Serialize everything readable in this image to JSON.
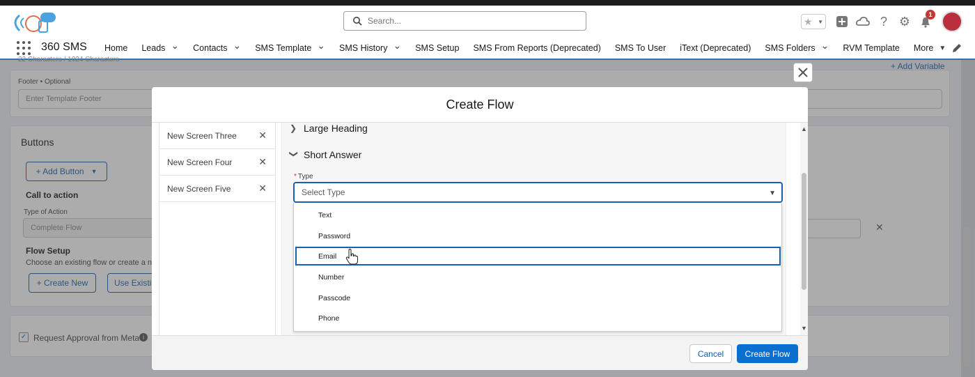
{
  "header": {
    "search_placeholder": "Search...",
    "notification_count": "1"
  },
  "nav": {
    "app_name": "360 SMS",
    "items": [
      {
        "label": "Home",
        "has_menu": false
      },
      {
        "label": "Leads",
        "has_menu": true
      },
      {
        "label": "Contacts",
        "has_menu": true
      },
      {
        "label": "SMS Template",
        "has_menu": true
      },
      {
        "label": "SMS History",
        "has_menu": true
      },
      {
        "label": "SMS Setup",
        "has_menu": false
      },
      {
        "label": "SMS From Reports (Deprecated)",
        "has_menu": false
      },
      {
        "label": "SMS To User",
        "has_menu": false
      },
      {
        "label": "iText (Deprecated)",
        "has_menu": false
      },
      {
        "label": "SMS Folders",
        "has_menu": true
      },
      {
        "label": "RVM Template",
        "has_menu": false
      },
      {
        "label": "More",
        "has_menu": true
      }
    ]
  },
  "background": {
    "char_count": "22 Characters / 1024 Characters",
    "footer_label": "Footer • Optional",
    "footer_placeholder": "Enter Template Footer",
    "add_variable": "+ Add Variable",
    "buttons_title": "Buttons",
    "add_button": "+ Add Button",
    "call_to_action": "Call to action",
    "type_of_action_label": "Type of Action",
    "type_of_action_value": "Complete Flow",
    "flow_setup_title": "Flow Setup",
    "flow_setup_desc": "Choose an existing flow or create a n",
    "create_new": "+ Create New",
    "use_existing": "Use Existin",
    "request_approval": "Request Approval from Meta"
  },
  "modal": {
    "title": "Create Flow",
    "screens": [
      "New Screen Three",
      "New Screen Four",
      "New Screen Five"
    ],
    "sections": {
      "large_heading": "Large Heading",
      "short_answer": "Short Answer"
    },
    "type_label": "Type",
    "type_placeholder": "Select Type",
    "options": [
      "Text",
      "Password",
      "Email",
      "Number",
      "Passcode",
      "Phone"
    ],
    "highlighted_option": "Email",
    "cancel_label": "Cancel",
    "create_label": "Create Flow"
  }
}
